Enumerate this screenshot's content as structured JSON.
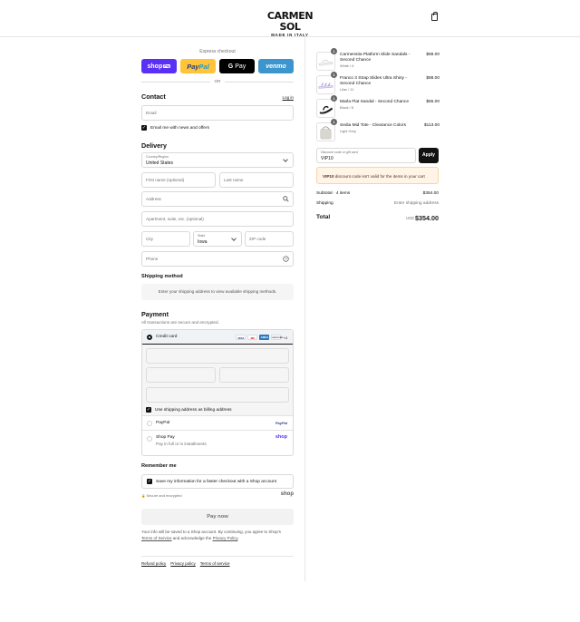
{
  "header": {
    "brand": "CARMEN SOL",
    "brand_sub": "MADE IN ITALY",
    "cart_icon": "shopping-bag-icon"
  },
  "express": {
    "label": "Express checkout",
    "shop_pay": {
      "text": "shop",
      "badge": "Pay"
    },
    "paypal": {
      "pay": "Pay",
      "pal": "Pal"
    },
    "gpay": {
      "g": "G",
      "text": "Pay"
    },
    "venmo": "venmo",
    "or": "OR"
  },
  "contact": {
    "heading": "Contact",
    "login": "Log in",
    "email_placeholder": "Email",
    "newsletter_label": "Email me with news and offers"
  },
  "delivery": {
    "heading": "Delivery",
    "country_label": "Country/Region",
    "country_value": "United States",
    "first_name": "First name (optional)",
    "last_name": "Last name",
    "address": "Address",
    "apartment": "Apartment, suite, etc. (optional)",
    "city": "City",
    "state_label": "State",
    "state_value": "Iowa",
    "zip": "ZIP code",
    "phone": "Phone"
  },
  "shipping": {
    "heading": "Shipping method",
    "notice": "Enter your shipping address to view available shipping methods."
  },
  "payment": {
    "heading": "Payment",
    "subtext": "All transactions are secure and encrypted.",
    "credit_card": "Credit card",
    "card_brands": [
      "VISA",
      "MC",
      "AMEX",
      "DISCOVER"
    ],
    "more_cards": "+4",
    "billing_label": "Use shipping address as billing address",
    "paypal": "PayPal",
    "paypal_logo": "PayPal",
    "shop_pay": "Shop Pay",
    "shop_pay_sub": "Pay in full or in installments",
    "shop_pay_logo": "shop"
  },
  "remember": {
    "heading": "Remember me",
    "save_label": "Save my information for a faster checkout with a Shop account",
    "secure": "Secure and encrypted",
    "shop_logo": "shop"
  },
  "pay_now": "Pay now",
  "legal": {
    "text1": "Your info will be saved to a Shop account. By continuing, you agree to Shop's",
    "terms": "Terms of Service",
    "text2": "and acknowledge the",
    "privacy": "Privacy Policy",
    "end": "."
  },
  "footer": {
    "refund": "Refund policy",
    "privacy": "Privacy policy",
    "terms": "Terms of service"
  },
  "cart": {
    "items": [
      {
        "qty": "1",
        "name": "Carmensita Platform Slide Sandals - Second Chance",
        "variant": "White / 6",
        "price": "$88.00"
      },
      {
        "qty": "1",
        "name": "Franco 3 Strap Slides Ultra Shiny - Second Chance",
        "variant": "Lilac / 11",
        "price": "$88.00"
      },
      {
        "qty": "1",
        "name": "Marla Flat Sandal - Second Chance",
        "variant": "Black / 8",
        "price": "$65.00"
      },
      {
        "qty": "1",
        "name": "Sedia Mid Tote - Clearance Colors",
        "variant": "Light Grey",
        "price": "$113.00"
      }
    ],
    "discount_label": "Discount code or gift card",
    "discount_value": "VIP10",
    "apply": "Apply",
    "warning_code": "VIP10",
    "warning_text": "discount code isn't valid for the items in your cart",
    "subtotal_label": "Subtotal · 4 items",
    "subtotal": "$354.00",
    "shipping_label": "Shipping",
    "shipping_value": "Enter shipping address",
    "total_label": "Total",
    "currency": "USD",
    "total": "$354.00"
  }
}
